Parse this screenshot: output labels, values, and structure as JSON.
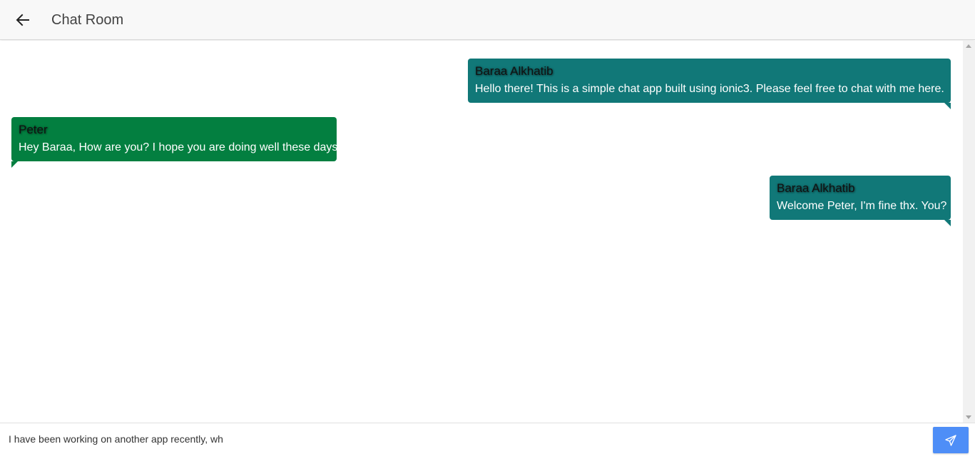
{
  "header": {
    "title": "Chat Room",
    "back_icon": "arrow-back-icon"
  },
  "messages": [
    {
      "sender": "Baraa Alkhatib",
      "text": "Hello there! This is a simple chat app built using ionic3. Please feel free to chat with me here.",
      "side": "right"
    },
    {
      "sender": "Peter",
      "text": "Hey Baraa, How are you? I hope you are doing well these days",
      "side": "left"
    },
    {
      "sender": "Baraa Alkhatib",
      "text": "Welcome Peter, I'm fine thx. You?",
      "side": "right"
    }
  ],
  "composer": {
    "value": "I have been working on another app recently, wh",
    "send_icon": "send-icon"
  },
  "colors": {
    "own_bubble": "#117878",
    "other_bubble": "#037f40",
    "send_button": "#4e8ef7",
    "header_bg": "#f8f8f8"
  }
}
